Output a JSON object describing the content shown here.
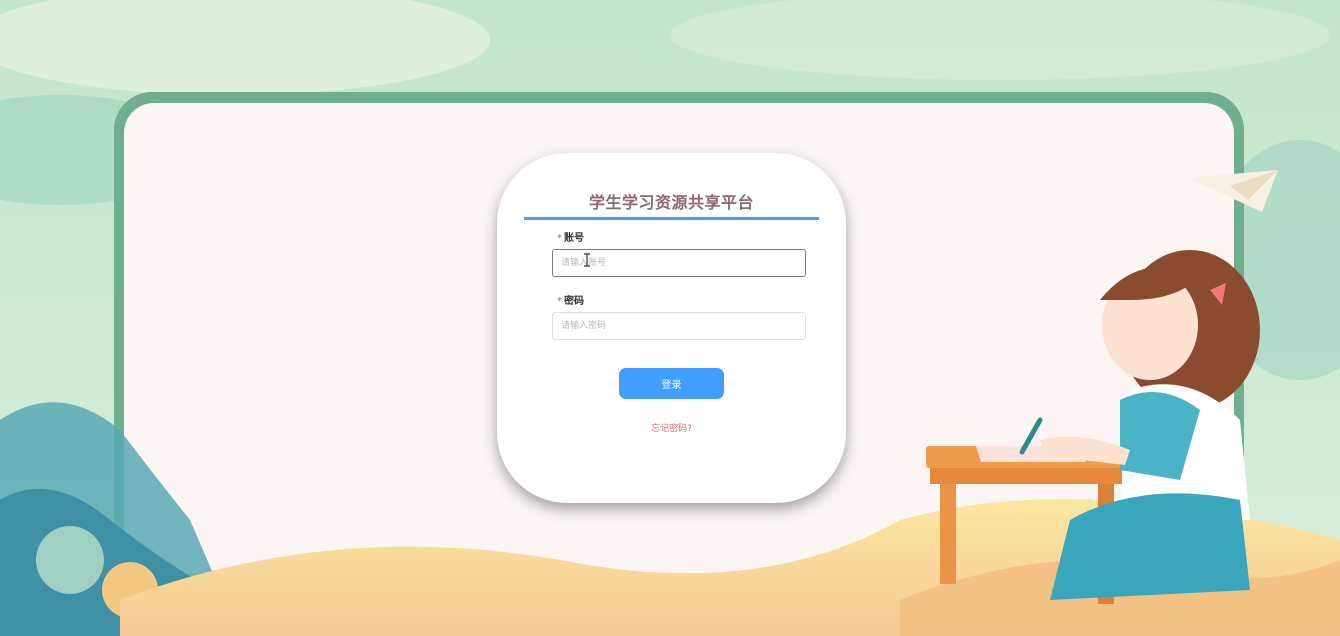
{
  "login": {
    "title": "学生学习资源共享平台",
    "required_mark": "*",
    "account_label": "账号",
    "account_placeholder": "请输入账号",
    "account_value": "",
    "password_label": "密码",
    "password_placeholder": "请输入密码",
    "password_value": "",
    "login_button": "登录",
    "forgot_link": "忘记密码?"
  },
  "colors": {
    "accent": "#409eff",
    "title_underline": "#4d9df0",
    "title_text": "#8a6b6b",
    "required": "#e0564e",
    "forgot_link": "#e06a6a",
    "frame": "#6fae8f",
    "panel": "#fbf5f4"
  },
  "icons": {
    "decor_paper_plane": "paper-plane-icon",
    "decor_girl": "girl-studying-illustration",
    "text_cursor": "text-cursor-icon"
  }
}
